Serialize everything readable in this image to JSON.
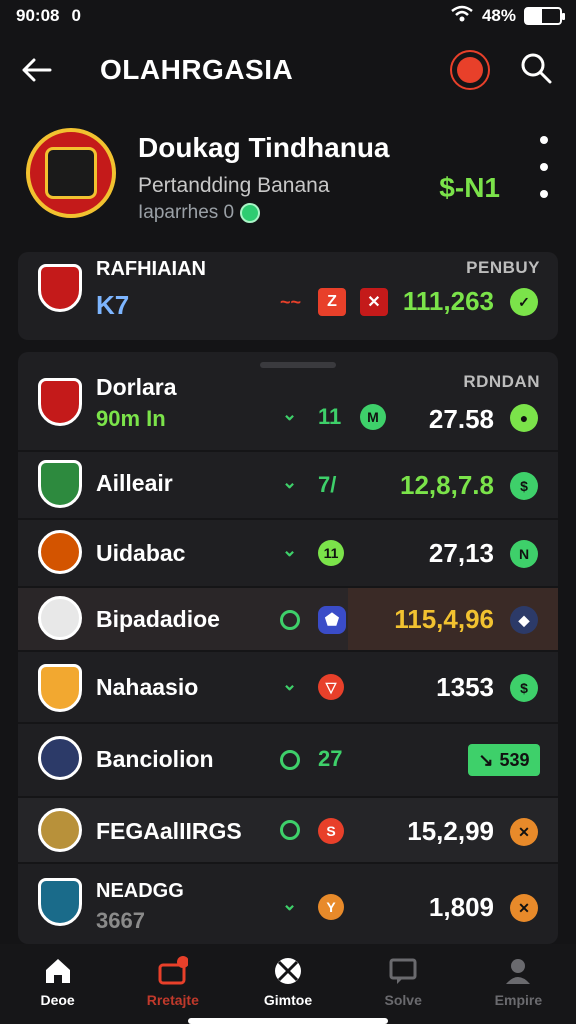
{
  "status_bar": {
    "time": "90:08",
    "extra": "0",
    "battery": "48%",
    "battery_level": 0.48
  },
  "app_bar": {
    "title": "OLAHRGASIA"
  },
  "profile": {
    "name": "Doukag Tindhanua",
    "subtitle": "Pertandding Banana",
    "subtitle2": "Iaparrhes 0",
    "score": "$-N1"
  },
  "top_card": {
    "team": "RAFHIAIAN",
    "code": "K7",
    "column_label": "PENBUY",
    "value": "111,263",
    "icons": [
      "wave-icon",
      "close-icon",
      "close-icon",
      "check-icon"
    ]
  },
  "main_card": {
    "column_label": "RDNDAN",
    "rows": [
      {
        "name": "Dorlara",
        "sub": "90m In",
        "mid": "11",
        "value": "27.58",
        "value_color": "#ffffff"
      },
      {
        "name": "Ailleair",
        "sub": "",
        "mid": "7/",
        "value": "12,8,7.8",
        "value_color": "#7be34a"
      },
      {
        "name": "Uidabac",
        "sub": "",
        "mid": "11",
        "value": "27,13",
        "value_color": "#ffffff"
      },
      {
        "name": "Bipadadioe",
        "sub": "",
        "mid": "",
        "value": "115,4,96",
        "value_color": "#ffffff"
      },
      {
        "name": "Nahaasio",
        "sub": "",
        "mid": "",
        "value": "1353",
        "value_color": "#ffffff"
      },
      {
        "name": "Banciolion",
        "sub": "",
        "mid": "27",
        "value": "539",
        "value_color": "#111111"
      },
      {
        "name": "FEGAalIIRGS",
        "sub": "",
        "mid": "",
        "value": "15,2,99",
        "value_color": "#ffffff"
      },
      {
        "name": "NEADGG",
        "sub": "3667",
        "mid": "",
        "value": "1,809",
        "value_color": "#ffffff"
      }
    ]
  },
  "bottom_nav": {
    "items": [
      {
        "label": "Deoe",
        "icon": "home-icon"
      },
      {
        "label": "Rretajte",
        "icon": "briefcase-icon"
      },
      {
        "label": "Gimtoe",
        "icon": "soccer-ball-icon"
      },
      {
        "label": "Solve",
        "icon": "message-icon"
      },
      {
        "label": "Empire",
        "icon": "profile-icon"
      }
    ]
  },
  "colors": {
    "accent": "#3ed06a",
    "highlight": "#7be34a",
    "alert": "#e8402a"
  }
}
